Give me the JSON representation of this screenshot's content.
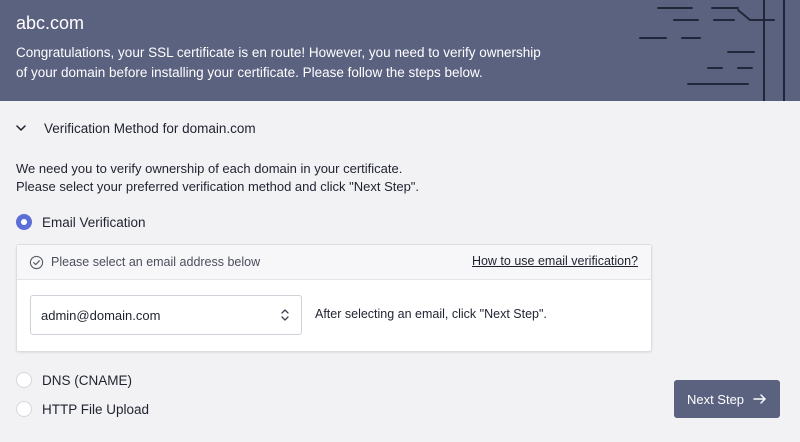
{
  "header": {
    "domain": "abc.com",
    "message_line1": "Congratulations, your SSL certificate is en route! However, you need to verify ownership",
    "message_line2": "of your domain before installing your certificate. Please follow the steps below."
  },
  "section": {
    "title": "Verification Method for domain.com",
    "intro_line1": "We need you to verify ownership of each domain in your certificate.",
    "intro_line2": "Please select your preferred verification method and click \"Next Step\"."
  },
  "methods": [
    {
      "label": "Email Verification",
      "selected": true
    },
    {
      "label": "DNS (CNAME)",
      "selected": false
    },
    {
      "label": "HTTP File Upload",
      "selected": false
    }
  ],
  "email_panel": {
    "prompt": "Please select an email address below",
    "help_link": "How to use email verification?",
    "selected_email": "admin@domain.com",
    "after_note": "After selecting an email, click \"Next Step\"."
  },
  "actions": {
    "next_label": "Next Step"
  },
  "colors": {
    "header_bg": "#5b6280",
    "accent_radio": "#5b6fd6",
    "page_bg": "#f2f2f4"
  },
  "icons": {
    "chevron": "chevron-down-icon",
    "check": "check-circle-icon",
    "select": "up-down-chevron-icon",
    "arrow": "arrow-right-icon"
  }
}
